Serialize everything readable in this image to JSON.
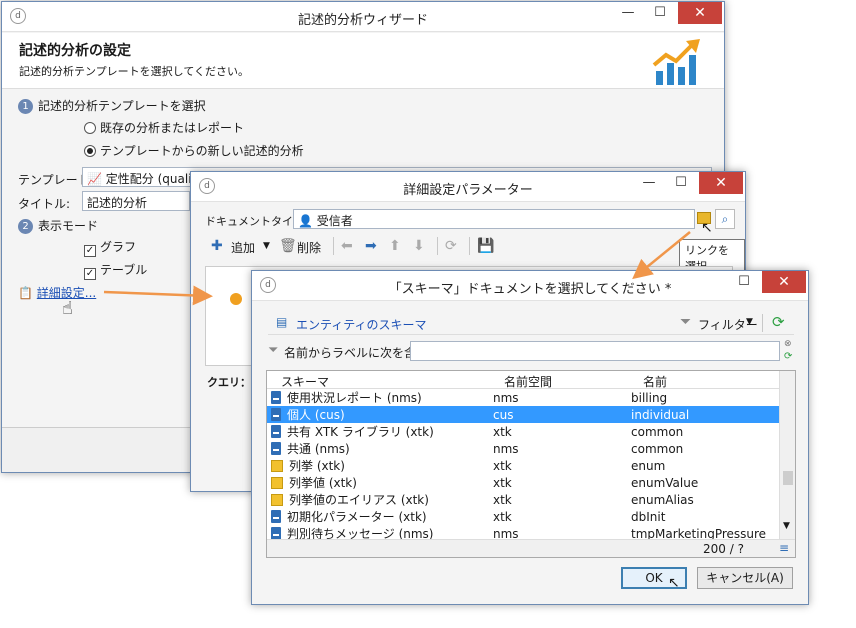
{
  "main": {
    "title": "記述的分析ウィザード",
    "heading": "記述的分析の設定",
    "subheading": "記述的分析テンプレートを選択してください。",
    "step1_num": "1",
    "step1": "記述的分析テンプレートを選択",
    "radio1": "既存の分析またはレポート",
    "radio2": "テンプレートからの新しい記述的分析",
    "template_label": "テンプレート:",
    "template_value": "定性配分 (qualit",
    "title_label": "タイトル:",
    "title_value": "記述的分析",
    "step2_num": "2",
    "step2": "表示モード",
    "check_graph": "グラフ",
    "check_table": "テーブル",
    "advanced_link": "詳細設定..."
  },
  "params": {
    "title": "詳細設定パラメーター",
    "doctype_label": "ドキュメントタイプ:",
    "doctype_value": "受信者",
    "add_label": "追加",
    "delete_label": "削除",
    "tooltip": "リンクを選択",
    "query_label": "クエリ：:"
  },
  "schema": {
    "title": "「スキーマ」ドキュメントを選択してください *",
    "entity_link": "エンティティのスキーマ",
    "filter_label": "フィルター",
    "search_label": "名前からラベルに次を含む:",
    "search_value": "",
    "columns": [
      "スキーマ",
      "名前空間",
      "名前"
    ],
    "rows": [
      {
        "schema": "使用状況レポート (nms)",
        "ns": "nms",
        "name": "billing",
        "icon": "doc"
      },
      {
        "schema": "個人 (cus)",
        "ns": "cus",
        "name": "individual",
        "icon": "person",
        "selected": true
      },
      {
        "schema": "共有 XTK ライブラリ (xtk)",
        "ns": "xtk",
        "name": "common",
        "icon": "doc"
      },
      {
        "schema": "共通 (nms)",
        "ns": "nms",
        "name": "common",
        "icon": "doc"
      },
      {
        "schema": "列挙 (xtk)",
        "ns": "xtk",
        "name": "enum",
        "icon": "enum"
      },
      {
        "schema": "列挙値 (xtk)",
        "ns": "xtk",
        "name": "enumValue",
        "icon": "enum"
      },
      {
        "schema": "列挙値のエイリアス (xtk)",
        "ns": "xtk",
        "name": "enumAlias",
        "icon": "enum"
      },
      {
        "schema": "初期化パラメーター (xtk)",
        "ns": "xtk",
        "name": "dbInit",
        "icon": "doc"
      },
      {
        "schema": "判別待ちメッセージ (nms)",
        "ns": "nms",
        "name": "tmpMarketingPressure",
        "icon": "doc"
      }
    ],
    "count": "200 / ?",
    "ok_label": "OK",
    "cancel_label": "キャンセル(A)"
  },
  "colors": {
    "accent": "#3399ff",
    "arrow": "#f0964a",
    "close": "#c7423a"
  }
}
